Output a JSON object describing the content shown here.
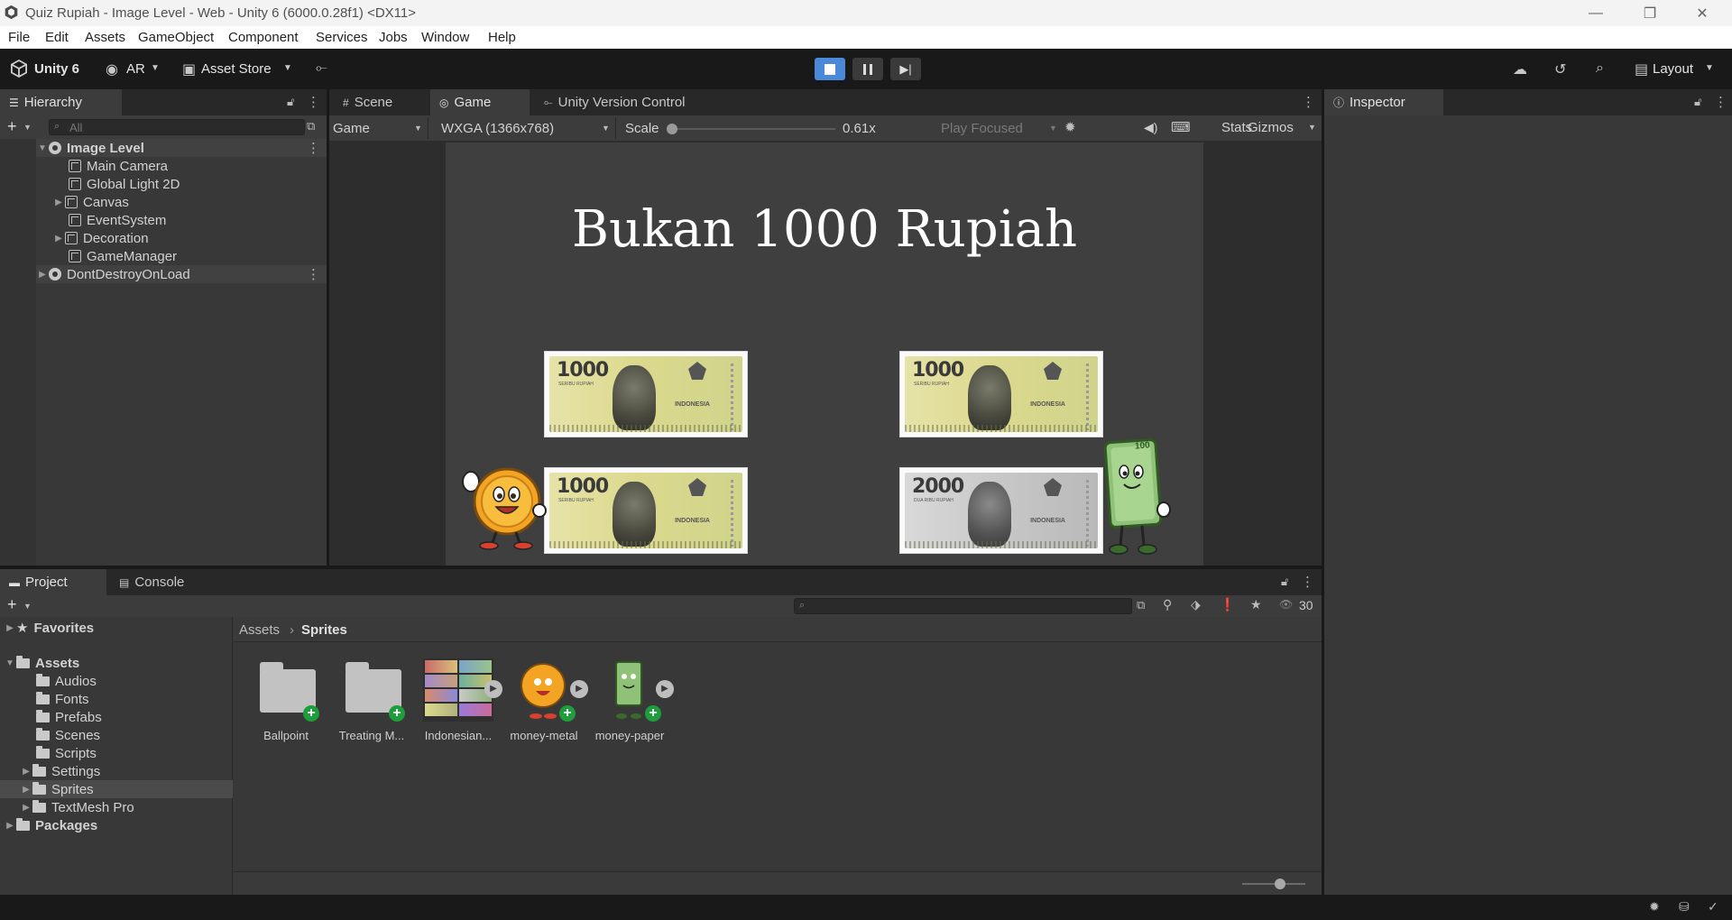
{
  "window": {
    "title": "Quiz Rupiah - Image Level - Web - Unity 6 (6000.0.28f1) <DX11>",
    "minimize": "—",
    "maximize": "❐",
    "close": "✕"
  },
  "menu": [
    "File",
    "Edit",
    "Assets",
    "GameObject",
    "Component",
    "Services",
    "Jobs",
    "Window",
    "Help"
  ],
  "toolbar": {
    "unity_label": "Unity 6",
    "account": "AR",
    "asset_store": "Asset Store",
    "layout": "Layout"
  },
  "hierarchy": {
    "tab": "Hierarchy",
    "search_placeholder": "All",
    "items": [
      {
        "label": "Image Level"
      },
      {
        "label": "Main Camera"
      },
      {
        "label": "Global Light 2D"
      },
      {
        "label": "Canvas"
      },
      {
        "label": "EventSystem"
      },
      {
        "label": "Decoration"
      },
      {
        "label": "GameManager"
      },
      {
        "label": "DontDestroyOnLoad"
      }
    ]
  },
  "game_tabs": {
    "scene": "Scene",
    "game": "Game",
    "uvc": "Unity Version Control"
  },
  "game_toolbar": {
    "display": "Game",
    "resolution": "WXGA (1366x768)",
    "scale_label": "Scale",
    "scale_value": "0.61x",
    "play_focused": "Play Focused",
    "stats": "Stats",
    "gizmos": "Gizmos"
  },
  "game": {
    "question": "Bukan 1000 Rupiah",
    "notes": [
      {
        "value": "1000",
        "sub": "SERIBU RUPIAH",
        "country": "INDONESIA"
      },
      {
        "value": "1000",
        "sub": "SERIBU RUPIAH",
        "country": "INDONESIA"
      },
      {
        "value": "1000",
        "sub": "SERIBU RUPIAH",
        "country": "INDONESIA"
      },
      {
        "value": "2000",
        "sub": "DUA RIBU RUPIAH",
        "country": "INDONESIA"
      }
    ],
    "mascot_paper_value": "100"
  },
  "inspector": {
    "tab": "Inspector"
  },
  "project": {
    "tab_project": "Project",
    "tab_console": "Console",
    "count": "30",
    "breadcrumb_root": "Assets",
    "breadcrumb_current": "Sprites",
    "tree": {
      "favorites": "Favorites",
      "assets": "Assets",
      "children": [
        "Audios",
        "Fonts",
        "Prefabs",
        "Scenes",
        "Scripts",
        "Settings",
        "Sprites",
        "TextMesh Pro"
      ],
      "packages": "Packages"
    },
    "assets": [
      {
        "label": "Ballpoint"
      },
      {
        "label": "Treating M..."
      },
      {
        "label": "Indonesian..."
      },
      {
        "label": "money-metal"
      },
      {
        "label": "money-paper"
      }
    ]
  },
  "colors": {
    "accent": "#4a88d8",
    "panel": "#383838",
    "toolbar": "#191919",
    "add_badge": "#1f9c3c"
  }
}
